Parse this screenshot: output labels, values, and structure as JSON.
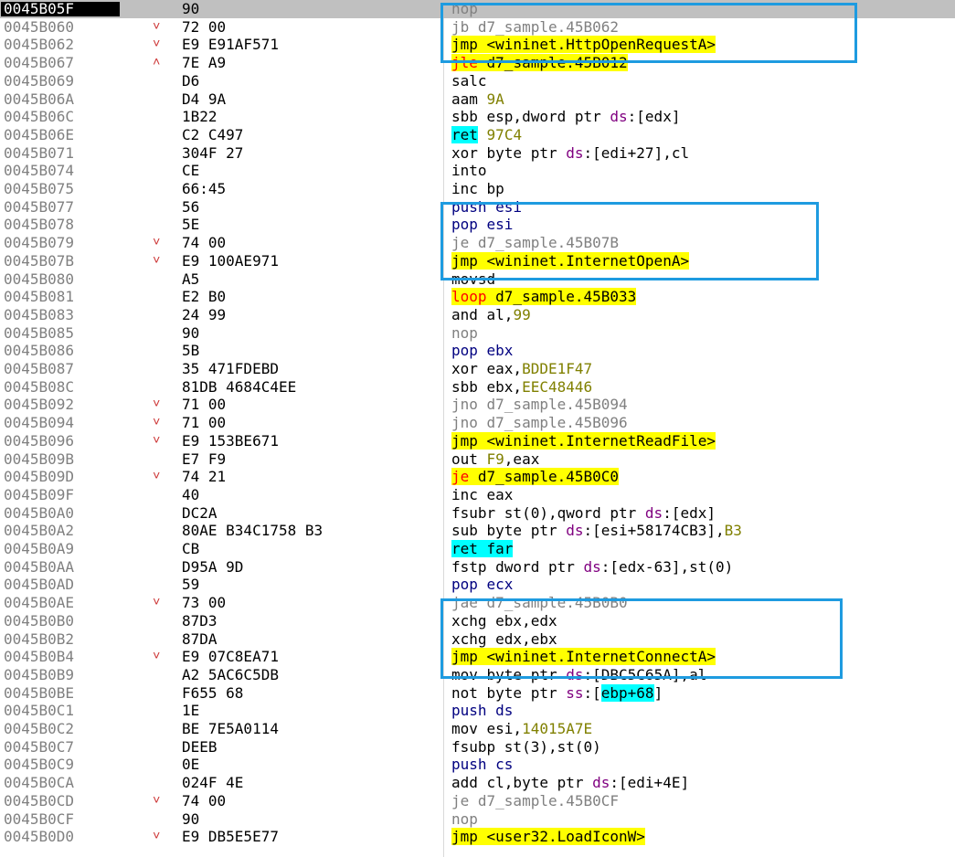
{
  "rows": [
    {
      "addr": "0045B05F",
      "arrow": "",
      "bytes": "90",
      "parts": [
        [
          "nop",
          "gray"
        ]
      ],
      "selected": true
    },
    {
      "addr": "0045B060",
      "arrow": "v",
      "bytes": "72 00",
      "parts": [
        [
          "jb d7_sample.45B062",
          "gray"
        ]
      ]
    },
    {
      "addr": "0045B062",
      "arrow": "v",
      "bytes": "E9 E91AF571",
      "parts": [
        [
          "jmp <wininet.HttpOpenRequestA>",
          "hl"
        ]
      ]
    },
    {
      "addr": "0045B067",
      "arrow": "^",
      "bytes": "7E A9",
      "parts": [
        [
          "jle",
          "red hl"
        ],
        [
          " d7_sample.45B012",
          "hl"
        ]
      ]
    },
    {
      "addr": "0045B069",
      "arrow": "",
      "bytes": "D6",
      "parts": [
        [
          "salc",
          ""
        ]
      ]
    },
    {
      "addr": "0045B06A",
      "arrow": "",
      "bytes": "D4 9A",
      "parts": [
        [
          "aam ",
          ""
        ],
        [
          "9A",
          "hex"
        ]
      ]
    },
    {
      "addr": "0045B06C",
      "arrow": "",
      "bytes": "1B22",
      "parts": [
        [
          "sbb esp,dword ptr ",
          ""
        ],
        [
          "ds",
          "seg"
        ],
        [
          ":[edx]",
          ""
        ]
      ]
    },
    {
      "addr": "0045B06E",
      "arrow": "",
      "bytes": "C2 C497",
      "parts": [
        [
          "ret",
          "hlc"
        ],
        [
          " ",
          ""
        ],
        [
          "97C4",
          "hex"
        ]
      ]
    },
    {
      "addr": "0045B071",
      "arrow": "",
      "bytes": "304F 27",
      "parts": [
        [
          "xor byte ptr ",
          ""
        ],
        [
          "ds",
          "seg"
        ],
        [
          ":[edi+27],cl",
          ""
        ]
      ]
    },
    {
      "addr": "0045B074",
      "arrow": "",
      "bytes": "CE",
      "parts": [
        [
          "into",
          ""
        ]
      ]
    },
    {
      "addr": "0045B075",
      "arrow": "",
      "bytes": "66:45",
      "parts": [
        [
          "inc bp",
          ""
        ]
      ]
    },
    {
      "addr": "0045B077",
      "arrow": "",
      "bytes": "56",
      "parts": [
        [
          "push esi",
          "blue"
        ]
      ]
    },
    {
      "addr": "0045B078",
      "arrow": "",
      "bytes": "5E",
      "parts": [
        [
          "pop esi",
          "blue"
        ]
      ]
    },
    {
      "addr": "0045B079",
      "arrow": "v",
      "bytes": "74 00",
      "parts": [
        [
          "je d7_sample.45B07B",
          "gray"
        ]
      ]
    },
    {
      "addr": "0045B07B",
      "arrow": "v",
      "bytes": "E9 100AE971",
      "parts": [
        [
          "jmp <wininet.InternetOpenA>",
          "hl"
        ]
      ]
    },
    {
      "addr": "0045B080",
      "arrow": "",
      "bytes": "A5",
      "parts": [
        [
          "movsd",
          ""
        ]
      ]
    },
    {
      "addr": "0045B081",
      "arrow": "",
      "bytes": "E2 B0",
      "parts": [
        [
          "loop",
          "red hl"
        ],
        [
          " d7_sample.45B033",
          "hl"
        ]
      ]
    },
    {
      "addr": "0045B083",
      "arrow": "",
      "bytes": "24 99",
      "parts": [
        [
          "and al,",
          ""
        ],
        [
          "99",
          "hex"
        ]
      ]
    },
    {
      "addr": "0045B085",
      "arrow": "",
      "bytes": "90",
      "parts": [
        [
          "nop",
          "gray"
        ]
      ]
    },
    {
      "addr": "0045B086",
      "arrow": "",
      "bytes": "5B",
      "parts": [
        [
          "pop ebx",
          "blue"
        ]
      ]
    },
    {
      "addr": "0045B087",
      "arrow": "",
      "bytes": "35 471FDEBD",
      "parts": [
        [
          "xor eax,",
          ""
        ],
        [
          "BDDE1F47",
          "hex"
        ]
      ]
    },
    {
      "addr": "0045B08C",
      "arrow": "",
      "bytes": "81DB 4684C4EE",
      "parts": [
        [
          "sbb ebx,",
          ""
        ],
        [
          "EEC48446",
          "hex"
        ]
      ]
    },
    {
      "addr": "0045B092",
      "arrow": "v",
      "bytes": "71 00",
      "parts": [
        [
          "jno d7_sample.45B094",
          "gray"
        ]
      ]
    },
    {
      "addr": "0045B094",
      "arrow": "v",
      "bytes": "71 00",
      "parts": [
        [
          "jno d7_sample.45B096",
          "gray"
        ]
      ]
    },
    {
      "addr": "0045B096",
      "arrow": "v",
      "bytes": "E9 153BE671",
      "parts": [
        [
          "jmp <wininet.InternetReadFile>",
          "hl"
        ]
      ]
    },
    {
      "addr": "0045B09B",
      "arrow": "",
      "bytes": "E7 F9",
      "parts": [
        [
          "out ",
          ""
        ],
        [
          "F9",
          "hex"
        ],
        [
          ",eax",
          ""
        ]
      ]
    },
    {
      "addr": "0045B09D",
      "arrow": "v",
      "bytes": "74 21",
      "parts": [
        [
          "je",
          "red hl"
        ],
        [
          " d7_sample.45B0C0",
          "hl"
        ]
      ]
    },
    {
      "addr": "0045B09F",
      "arrow": "",
      "bytes": "40",
      "parts": [
        [
          "inc eax",
          ""
        ]
      ]
    },
    {
      "addr": "0045B0A0",
      "arrow": "",
      "bytes": "DC2A",
      "parts": [
        [
          "fsubr st(0),qword ptr ",
          ""
        ],
        [
          "ds",
          "seg"
        ],
        [
          ":[edx]",
          ""
        ]
      ]
    },
    {
      "addr": "0045B0A2",
      "arrow": "",
      "bytes": "80AE B34C1758 B3",
      "parts": [
        [
          "sub byte ptr ",
          ""
        ],
        [
          "ds",
          "seg"
        ],
        [
          ":[esi+58174CB3],",
          ""
        ],
        [
          "B3",
          "hex"
        ]
      ]
    },
    {
      "addr": "0045B0A9",
      "arrow": "",
      "bytes": "CB",
      "parts": [
        [
          "ret far",
          "hlc"
        ]
      ]
    },
    {
      "addr": "0045B0AA",
      "arrow": "",
      "bytes": "D95A 9D",
      "parts": [
        [
          "fstp dword ptr ",
          ""
        ],
        [
          "ds",
          "seg"
        ],
        [
          ":[edx-63],st(0)",
          ""
        ]
      ]
    },
    {
      "addr": "0045B0AD",
      "arrow": "",
      "bytes": "59",
      "parts": [
        [
          "pop ecx",
          "blue"
        ]
      ]
    },
    {
      "addr": "0045B0AE",
      "arrow": "v",
      "bytes": "73 00",
      "parts": [
        [
          "jae d7_sample.45B0B0",
          "gray"
        ]
      ]
    },
    {
      "addr": "0045B0B0",
      "arrow": "",
      "bytes": "87D3",
      "parts": [
        [
          "xchg ebx,edx",
          ""
        ]
      ]
    },
    {
      "addr": "0045B0B2",
      "arrow": "",
      "bytes": "87DA",
      "parts": [
        [
          "xchg edx,ebx",
          ""
        ]
      ]
    },
    {
      "addr": "0045B0B4",
      "arrow": "v",
      "bytes": "E9 07C8EA71",
      "parts": [
        [
          "jmp <wininet.InternetConnectA>",
          "hl"
        ]
      ]
    },
    {
      "addr": "0045B0B9",
      "arrow": "",
      "bytes": "A2 5AC6C5DB",
      "parts": [
        [
          "mov byte ptr ",
          ""
        ],
        [
          "ds",
          "seg"
        ],
        [
          ":[DBC5C65A],al",
          ""
        ]
      ]
    },
    {
      "addr": "0045B0BE",
      "arrow": "",
      "bytes": "F655 68",
      "parts": [
        [
          "not byte ptr ",
          ""
        ],
        [
          "ss",
          "seg"
        ],
        [
          ":[",
          ""
        ],
        [
          "ebp+68",
          "hlc"
        ],
        [
          "]",
          ""
        ]
      ]
    },
    {
      "addr": "0045B0C1",
      "arrow": "",
      "bytes": "1E",
      "parts": [
        [
          "push ds",
          "blue"
        ]
      ]
    },
    {
      "addr": "0045B0C2",
      "arrow": "",
      "bytes": "BE 7E5A0114",
      "parts": [
        [
          "mov esi,",
          ""
        ],
        [
          "14015A7E",
          "hex"
        ]
      ]
    },
    {
      "addr": "0045B0C7",
      "arrow": "",
      "bytes": "DEEB",
      "parts": [
        [
          "fsubp st(3),st(0)",
          ""
        ]
      ]
    },
    {
      "addr": "0045B0C9",
      "arrow": "",
      "bytes": "0E",
      "parts": [
        [
          "push cs",
          "blue"
        ]
      ]
    },
    {
      "addr": "0045B0CA",
      "arrow": "",
      "bytes": "024F 4E",
      "parts": [
        [
          "add cl,byte ptr ",
          ""
        ],
        [
          "ds",
          "seg"
        ],
        [
          ":[edi+4E]",
          ""
        ]
      ]
    },
    {
      "addr": "0045B0CD",
      "arrow": "v",
      "bytes": "74 00",
      "parts": [
        [
          "je d7_sample.45B0CF",
          "gray"
        ]
      ]
    },
    {
      "addr": "0045B0CF",
      "arrow": "",
      "bytes": "90",
      "parts": [
        [
          "nop",
          "gray"
        ]
      ]
    },
    {
      "addr": "0045B0D0",
      "arrow": "v",
      "bytes": "E9 DB5E5E77",
      "parts": [
        [
          "jmp <user32.LoadIconW>",
          "hl"
        ]
      ]
    }
  ],
  "annotation_color": "#1e9be0",
  "highlight_color": "#ffff00"
}
